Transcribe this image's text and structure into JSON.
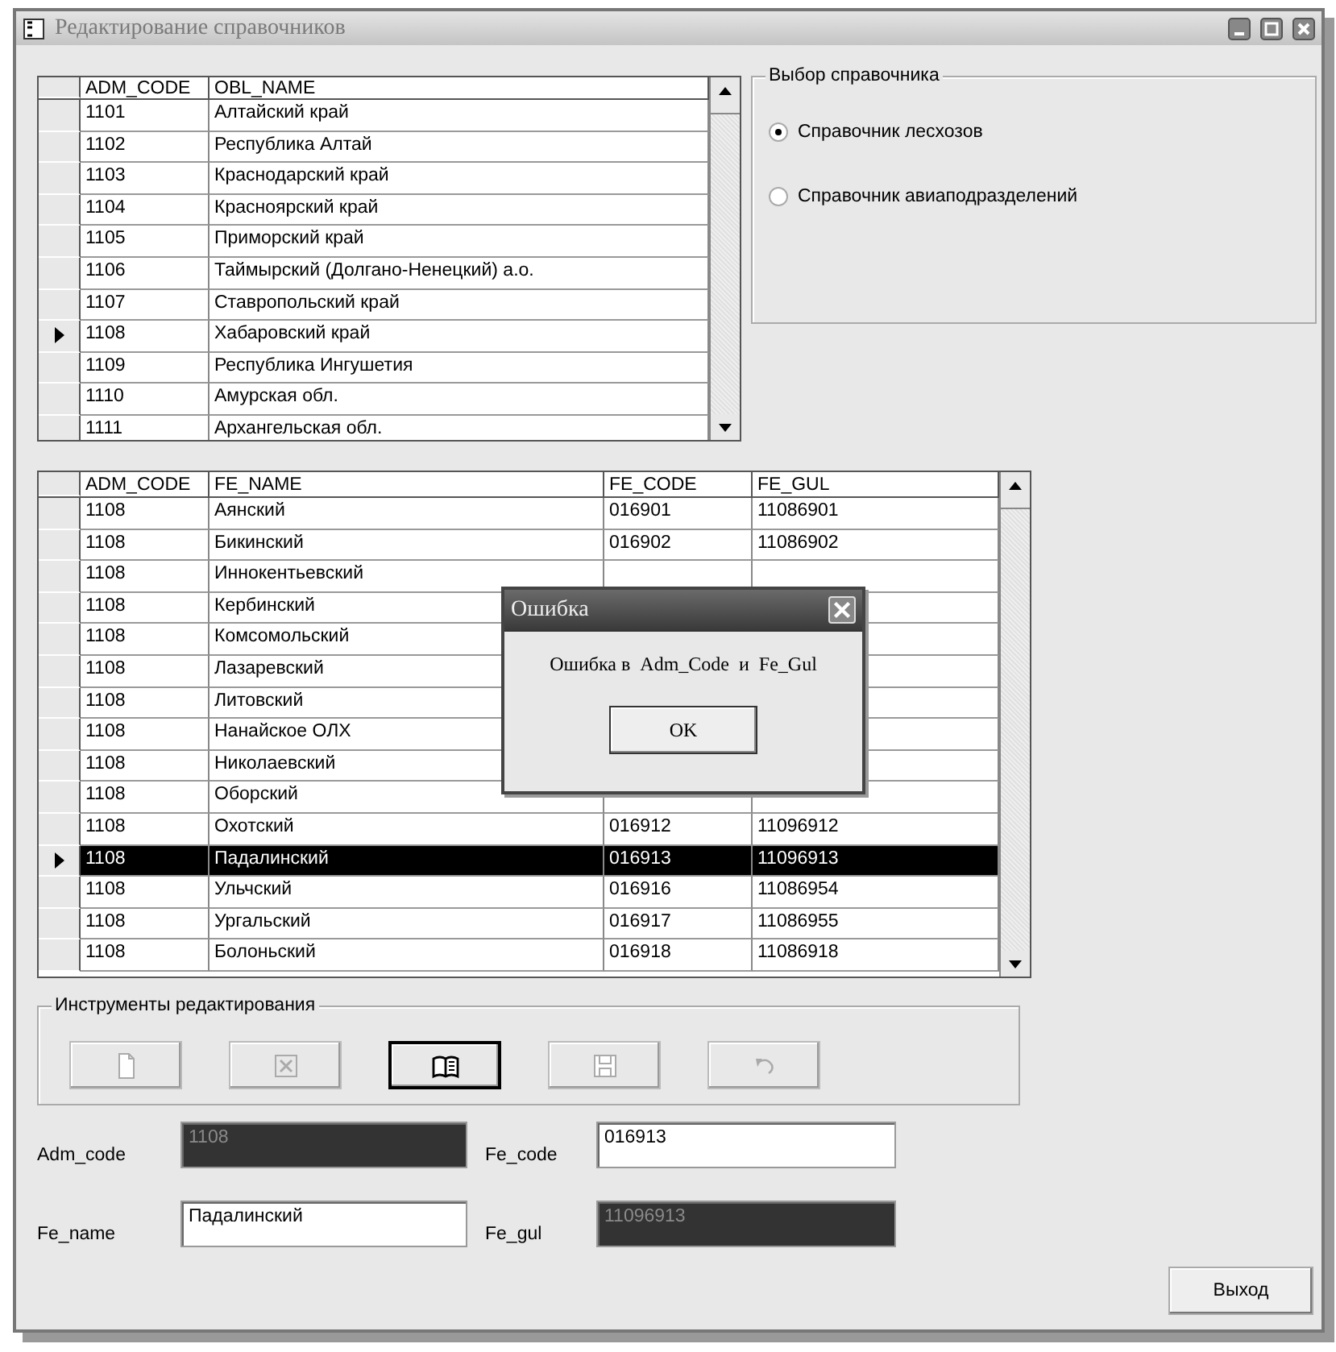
{
  "window": {
    "title": "Редактирование справочников"
  },
  "regions_grid": {
    "columns": [
      "ADM_CODE",
      "OBL_NAME"
    ],
    "rows": [
      {
        "adm_code": "1101",
        "obl_name": "Алтайский край",
        "selected": false
      },
      {
        "adm_code": "1102",
        "obl_name": "Республика Алтай",
        "selected": false
      },
      {
        "adm_code": "1103",
        "obl_name": "Краснодарский край",
        "selected": false
      },
      {
        "adm_code": "1104",
        "obl_name": "Красноярский край",
        "selected": false
      },
      {
        "adm_code": "1105",
        "obl_name": "Приморский край",
        "selected": false
      },
      {
        "adm_code": "1106",
        "obl_name": "Таймырский (Долгано-Ненецкий) а.о.",
        "selected": false
      },
      {
        "adm_code": "1107",
        "obl_name": "Ставропольский край",
        "selected": false
      },
      {
        "adm_code": "1108",
        "obl_name": "Хабаровский край",
        "selected": true
      },
      {
        "adm_code": "1109",
        "obl_name": "Республика Ингушетия",
        "selected": false
      },
      {
        "adm_code": "1110",
        "obl_name": "Амурская обл.",
        "selected": false
      },
      {
        "adm_code": "1111",
        "obl_name": "Архангельская обл.",
        "selected": false
      }
    ]
  },
  "directory_choice": {
    "title": "Выбор справочника",
    "options": [
      {
        "label": "Справочник лесхозов",
        "selected": true
      },
      {
        "label": "Справочник авиаподразделений",
        "selected": false
      }
    ]
  },
  "forestry_grid": {
    "columns": [
      "ADM_CODE",
      "FE_NAME",
      "FE_CODE",
      "FE_GUL"
    ],
    "rows": [
      {
        "adm_code": "1108",
        "fe_name": "Аянский",
        "fe_code": "016901",
        "fe_gul": "11086901",
        "selected": false
      },
      {
        "adm_code": "1108",
        "fe_name": "Бикинский",
        "fe_code": "016902",
        "fe_gul": "11086902",
        "selected": false
      },
      {
        "adm_code": "1108",
        "fe_name": "Иннокентьевский",
        "selected": false
      },
      {
        "adm_code": "1108",
        "fe_name": "Кербинский",
        "selected": false
      },
      {
        "adm_code": "1108",
        "fe_name": "Комсомольский",
        "selected": false
      },
      {
        "adm_code": "1108",
        "fe_name": "Лазаревский",
        "selected": false
      },
      {
        "adm_code": "1108",
        "fe_name": "Литовский",
        "selected": false
      },
      {
        "adm_code": "1108",
        "fe_name": "Нанайское ОЛХ",
        "selected": false
      },
      {
        "adm_code": "1108",
        "fe_name": "Николаевский",
        "selected": false
      },
      {
        "adm_code": "1108",
        "fe_name": "Оборский",
        "selected": false
      },
      {
        "adm_code": "1108",
        "fe_name": "Охотский",
        "fe_code": "016912",
        "fe_gul": "11096912",
        "selected": false
      },
      {
        "adm_code": "1108",
        "fe_name": "Падалинский",
        "fe_code": "016913",
        "fe_gul": "11096913",
        "selected": true
      },
      {
        "adm_code": "1108",
        "fe_name": "Ульчский",
        "fe_code": "016916",
        "fe_gul": "11086954",
        "selected": false
      },
      {
        "adm_code": "1108",
        "fe_name": "Ургальский",
        "fe_code": "016917",
        "fe_gul": "11086955",
        "selected": false
      },
      {
        "adm_code": "1108",
        "fe_name": "Болоньский",
        "fe_code": "016918",
        "fe_gul": "11086918",
        "selected": false
      }
    ]
  },
  "error_dialog": {
    "title": "Ошибка",
    "message": "Ошибка в  Adm_Code  и  Fe_Gul",
    "button": "OK"
  },
  "edit_tools": {
    "title": "Инструменты редактирования",
    "buttons": [
      {
        "kind": "new",
        "disabled": true
      },
      {
        "kind": "delete",
        "disabled": true
      },
      {
        "kind": "open",
        "disabled": false
      },
      {
        "kind": "save",
        "disabled": true
      },
      {
        "kind": "undo",
        "disabled": true
      }
    ]
  },
  "fields": [
    {
      "label": "Adm_code",
      "value": "1108",
      "readonly": true
    },
    {
      "label": "Fe_code",
      "value": "016913",
      "readonly": false
    },
    {
      "label": "Fe_name",
      "value": "Падалинский",
      "readonly": false
    },
    {
      "label": "Fe_gul",
      "value": "11096913",
      "readonly": true
    }
  ],
  "exit_button": "Выход"
}
